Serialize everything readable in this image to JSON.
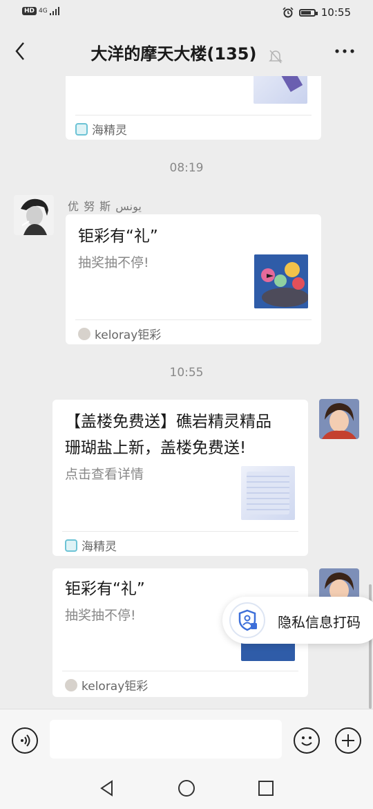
{
  "status_bar": {
    "network": "HD",
    "signal": "4G",
    "time": "10:55"
  },
  "nav": {
    "title": "大洋的摩天大楼(135)"
  },
  "messages": {
    "card1": {
      "source": "海精灵"
    },
    "time1": "08:19",
    "sender2": "优 努 斯 يونس",
    "card2": {
      "title": "钜彩有“礼”",
      "desc": "抽奖抽不停!",
      "source": "keloray钜彩"
    },
    "time2": "10:55",
    "card3": {
      "title_line1": "【盖楼免费送】礁岩精灵精品",
      "title_line2": "珊瑚盐上新，盖楼免费送!",
      "desc": "点击查看详情",
      "source": "海精灵"
    },
    "card4": {
      "title": "钜彩有“礼”",
      "desc": "抽奖抽不停!",
      "source": "keloray钜彩"
    }
  },
  "privacy_popup": {
    "label": "隐私信息打码"
  },
  "icons": {
    "back": "chevron-left-icon",
    "mute": "bell-off-icon",
    "more": "more-horizontal-icon",
    "voice": "voice-icon",
    "emoji": "emoji-icon",
    "plus": "plus-icon",
    "privacy": "shield-user-icon"
  }
}
